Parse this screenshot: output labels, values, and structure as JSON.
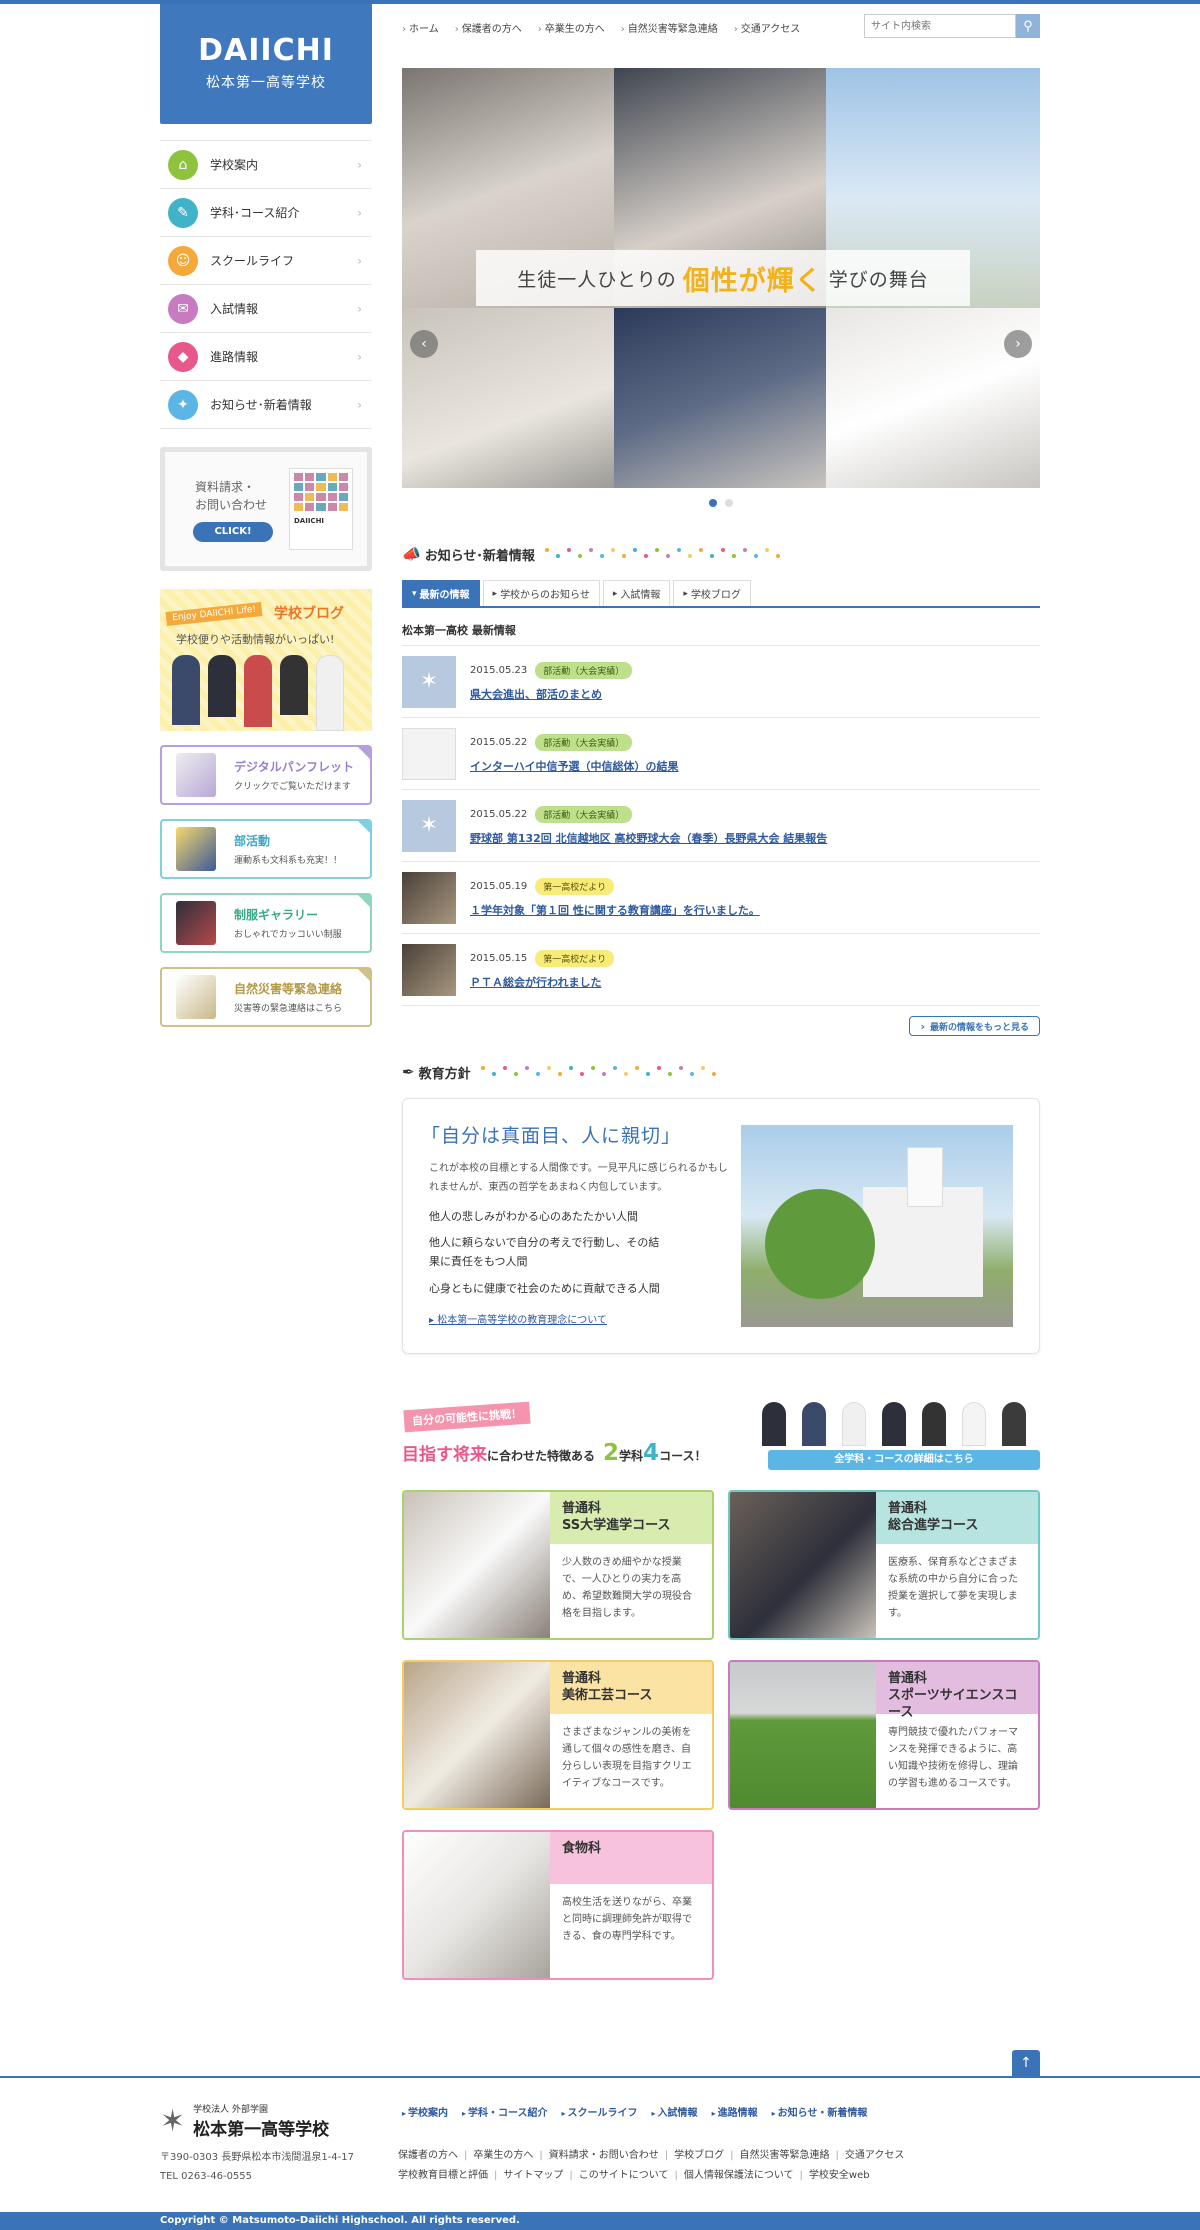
{
  "logo": {
    "en": "DAIICHI",
    "jp": "松本第一高等学校"
  },
  "nav": [
    {
      "label": "学校案内",
      "color": "#8fc33e",
      "icon": "school-icon",
      "glyph": "⌂"
    },
    {
      "label": "学科･コース紹介",
      "color": "#41b3c9",
      "icon": "pencil-icon",
      "glyph": "✎"
    },
    {
      "label": "スクールライフ",
      "color": "#f4a93a",
      "icon": "person-icon",
      "glyph": "☺"
    },
    {
      "label": "入試情報",
      "color": "#c77bc0",
      "icon": "clipboard-icon",
      "glyph": "✉"
    },
    {
      "label": "進路情報",
      "color": "#e9588c",
      "icon": "shield-icon",
      "glyph": "◆"
    },
    {
      "label": "お知らせ･新着情報",
      "color": "#5bb6e6",
      "icon": "ticket-icon",
      "glyph": "✦"
    }
  ],
  "request": {
    "line1": "資料請求・",
    "line2": "お問い合わせ",
    "button": "CLICK!",
    "brand": "DAIICHI"
  },
  "blog": {
    "tag": "Enjoy DAIICHI Life!",
    "title": "学校ブログ",
    "sub": "学校便りや活動情報がいっぱい!"
  },
  "side_banners": [
    {
      "title": "デジタルパンフレット",
      "sub": "クリックでご覧いただけます",
      "color": "#b5a0dc",
      "titleColor": "#9a7fcf"
    },
    {
      "title": "部活動",
      "sub": "運動系も文科系も充実！！",
      "color": "#7fd0e0",
      "titleColor": "#3fa7c6"
    },
    {
      "title": "制服ギャラリー",
      "sub": "おしゃれでカッコいい制服",
      "color": "#8fd6bc",
      "titleColor": "#3aa98a"
    },
    {
      "title": "自然災害等緊急連絡",
      "sub": "災害等の緊急連絡はこちら",
      "color": "#cfc08a",
      "titleColor": "#b39a44"
    }
  ],
  "utility_links": [
    "ホーム",
    "保護者の方へ",
    "卒業生の方へ",
    "自然災害等緊急連絡",
    "交通アクセス"
  ],
  "search": {
    "placeholder": "サイト内検索"
  },
  "hero": {
    "pre": "生徒一人ひとりの",
    "highlight": "個性が輝く",
    "post": "学びの舞台"
  },
  "news": {
    "heading": "お知らせ･新着情報",
    "tabs": [
      "最新の情報",
      "学校からのお知らせ",
      "入試情報",
      "学校ブログ"
    ],
    "subheading": "松本第一高校 最新情報",
    "items": [
      {
        "date": "2015.05.23",
        "category": "部活動（大会実績）",
        "title": "県大会進出、部活のまとめ",
        "thumb": "logo"
      },
      {
        "date": "2015.05.22",
        "category": "部活動（大会実績）",
        "title": "インターハイ中信予選（中信総体）の結果",
        "thumb": "doc"
      },
      {
        "date": "2015.05.22",
        "category": "部活動（大会実績）",
        "title": "野球部 第132回 北信越地区 高校野球大会（春季）長野県大会 結果報告",
        "thumb": "logo"
      },
      {
        "date": "2015.05.19",
        "category": "第一高校だより",
        "title": "１学年対象「第１回 性に関する教育講座」を行いました。",
        "thumb": "photo"
      },
      {
        "date": "2015.05.15",
        "category": "第一高校だより",
        "title": "ＰＴＡ総会が行われました",
        "thumb": "photo"
      }
    ],
    "more": "最新の情報をもっと見る"
  },
  "education": {
    "heading": "教育方針",
    "motto": "「自分は真面目、人に親切」",
    "intro": "これが本校の目標とする人間像です。一見平凡に感じられるかもしれませんが、東西の哲学をあまねく内包しています。",
    "points": [
      "他人の悲しみがわかる心のあたたかい人間",
      "他人に頼らないで自分の考えで行動し、その結果に責任をもつ人間",
      "心身ともに健康で社会のために貢献できる人間"
    ],
    "link": "松本第一高等学校の教育理念について"
  },
  "courses": {
    "pill": "自分の可能性に挑戦！",
    "title_pink": "目指す将来",
    "title_mid": "に合わせた特徴ある",
    "num1": "2",
    "unit1": "学科",
    "num2": "4",
    "unit2": "コース！",
    "button": "全学科・コースの詳細はこちら",
    "cards": [
      {
        "title": "普通科\nSS大学進学コース",
        "desc": "少人数のきめ細やかな授業で、一人ひとりの実力を高め、希望数難関大学の現役合格を目指します。",
        "color": "#a9d26b",
        "bg": "#d7ecae"
      },
      {
        "title": "普通科\n総合進学コース",
        "desc": "医療系、保育系などさまざまな系統の中から自分に合った授業を選択して夢を実現します。",
        "color": "#6ec9c5",
        "bg": "#b7e4e1"
      },
      {
        "title": "普通科\n美術工芸コース",
        "desc": "さまざまなジャンルの美術を通して個々の感性を磨き、自分らしい表現を目指すクリエイティブなコースです。",
        "color": "#f2cd63",
        "bg": "#fbe3a4"
      },
      {
        "title": "普通科\nスポーツサイエンスコース",
        "desc": "専門競技で優れたパフォーマンスを発揮できるように、高い知識や技術を修得し、理論の学習も進めるコースです。",
        "color": "#c77bc0",
        "bg": "#e3bde0"
      },
      {
        "title": "食物科",
        "desc": "高校生活を送りながら、卒業と同時に調理師免許が取得できる、食の専門学科です。",
        "color": "#ee8fbd",
        "bg": "#f6c2dc"
      }
    ]
  },
  "footer": {
    "corp": "学校法人 外部学園",
    "school": "松本第一高等学校",
    "address": "〒390-0303 長野県松本市浅間温泉1-4-17",
    "tel": "TEL 0263-46-0555",
    "nav1": [
      "学校案内",
      "学科・コース紹介",
      "スクールライフ",
      "入試情報",
      "進路情報",
      "お知らせ・新着情報"
    ],
    "nav2_row1": [
      "保護者の方へ",
      "卒業生の方へ",
      "資料請求・お問い合わせ",
      "学校ブログ",
      "自然災害等緊急連絡",
      "交通アクセス"
    ],
    "nav2_row2": [
      "学校教育目標と評価",
      "サイトマップ",
      "このサイトについて",
      "個人情報保護法について",
      "学校安全web"
    ],
    "copyright": "Copyright © Matsumoto-Daiichi Highschool. All rights reserved."
  }
}
